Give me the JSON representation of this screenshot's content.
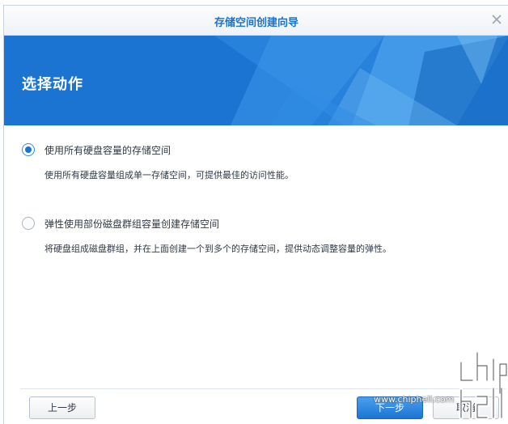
{
  "window": {
    "title": "存储空间创建向导",
    "close_icon": "close-icon"
  },
  "banner": {
    "heading": "选择动作",
    "color": "#1c74d2"
  },
  "options": [
    {
      "label": "使用所有硬盘容量的存储空间",
      "description": "使用所有硬盘容量组成单一存储空间，可提供最佳的访问性能。",
      "selected": true
    },
    {
      "label": "弹性使用部份磁盘群组容量创建存储空间",
      "description": "将硬盘组成磁盘群组，并在上面创建一个到多个的存储空间，提供动态调整容量的弹性。",
      "selected": false
    }
  ],
  "footer": {
    "prev_label": "上一步",
    "next_label": "下一步",
    "cancel_label": "取消"
  },
  "watermark": {
    "text": "www.chiphell.com",
    "logo_text": "chip hell"
  }
}
